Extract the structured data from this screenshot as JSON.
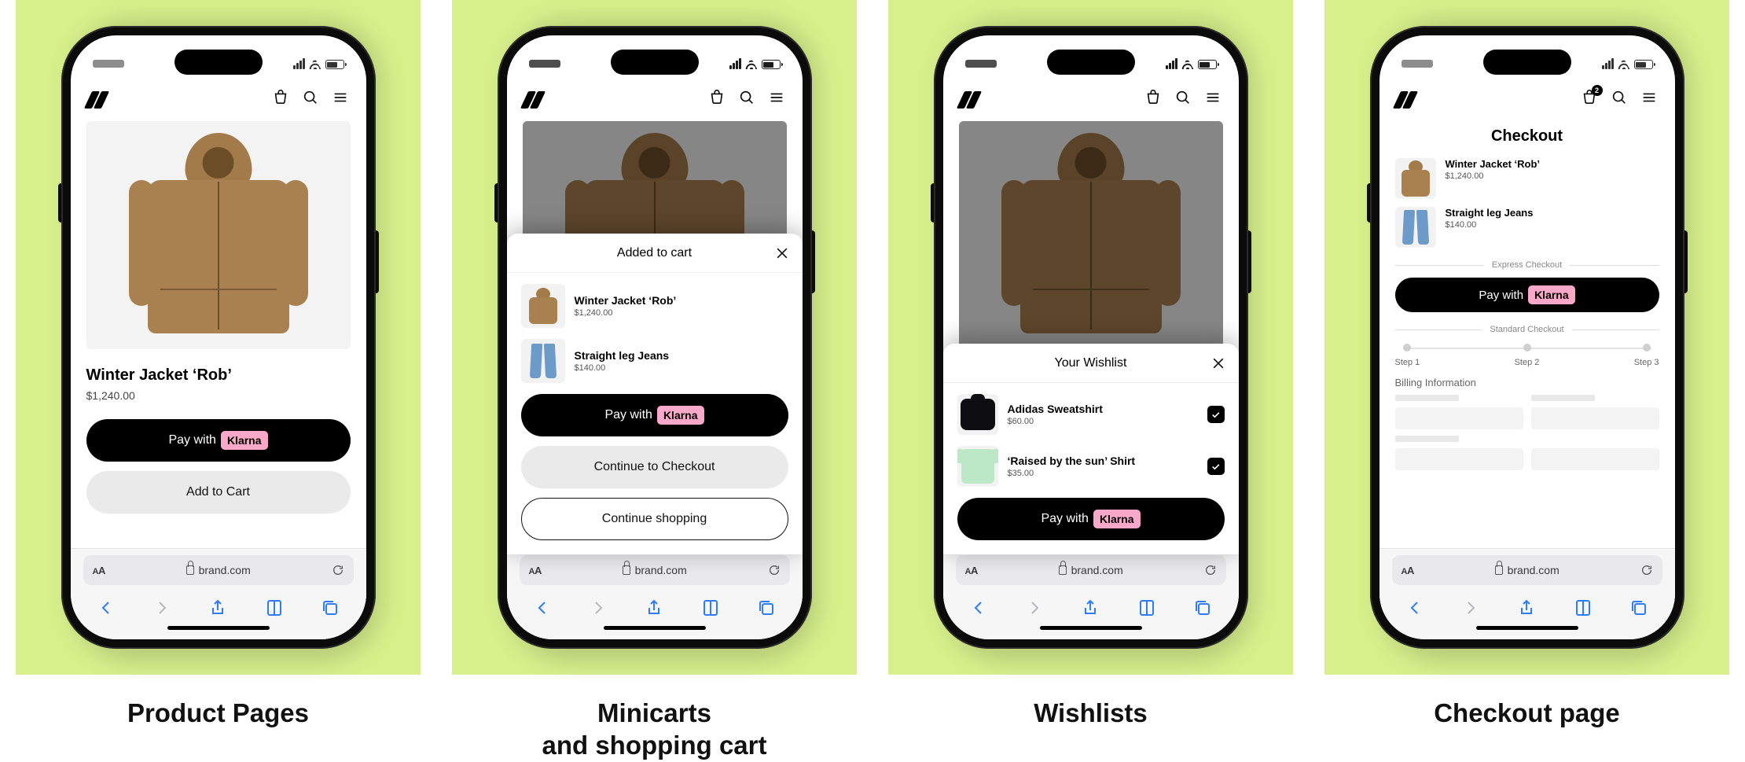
{
  "captions": {
    "product": "Product Pages",
    "minicart": "Minicarts\nand shopping cart",
    "wishlist": "Wishlists",
    "checkout": "Checkout page"
  },
  "browser": {
    "url": "brand.com",
    "text_size_label": "aA"
  },
  "klarna": {
    "prefix": "Pay with",
    "badge": "Klarna"
  },
  "product_page": {
    "title": "Winter Jacket ‘Rob’",
    "price": "$1,240.00",
    "add_to_cart": "Add to Cart"
  },
  "minicart": {
    "title": "Added to cart",
    "items": [
      {
        "name": "Winter Jacket ‘Rob’",
        "price": "$1,240.00",
        "thumb": "jacket"
      },
      {
        "name": "Straight leg Jeans",
        "price": "$140.00",
        "thumb": "jeans"
      }
    ],
    "continue_checkout": "Continue to Checkout",
    "continue_shopping": "Continue shopping"
  },
  "wishlist": {
    "title": "Your Wishlist",
    "items": [
      {
        "name": "Adidas Sweatshirt",
        "price": "$60.00",
        "thumb": "sweat",
        "checked": true
      },
      {
        "name": "‘Raised by the sun’ Shirt",
        "price": "$35.00",
        "thumb": "tee",
        "checked": true
      }
    ]
  },
  "checkout": {
    "title": "Checkout",
    "cart_badge": "2",
    "items": [
      {
        "name": "Winter Jacket ‘Rob’",
        "price": "$1,240.00",
        "thumb": "jacket"
      },
      {
        "name": "Straight leg Jeans",
        "price": "$140.00",
        "thumb": "jeans"
      }
    ],
    "express_label": "Express Checkout",
    "standard_label": "Standard Checkout",
    "steps": [
      "Step 1",
      "Step 2",
      "Step 3"
    ],
    "billing_label": "Billing Information"
  }
}
